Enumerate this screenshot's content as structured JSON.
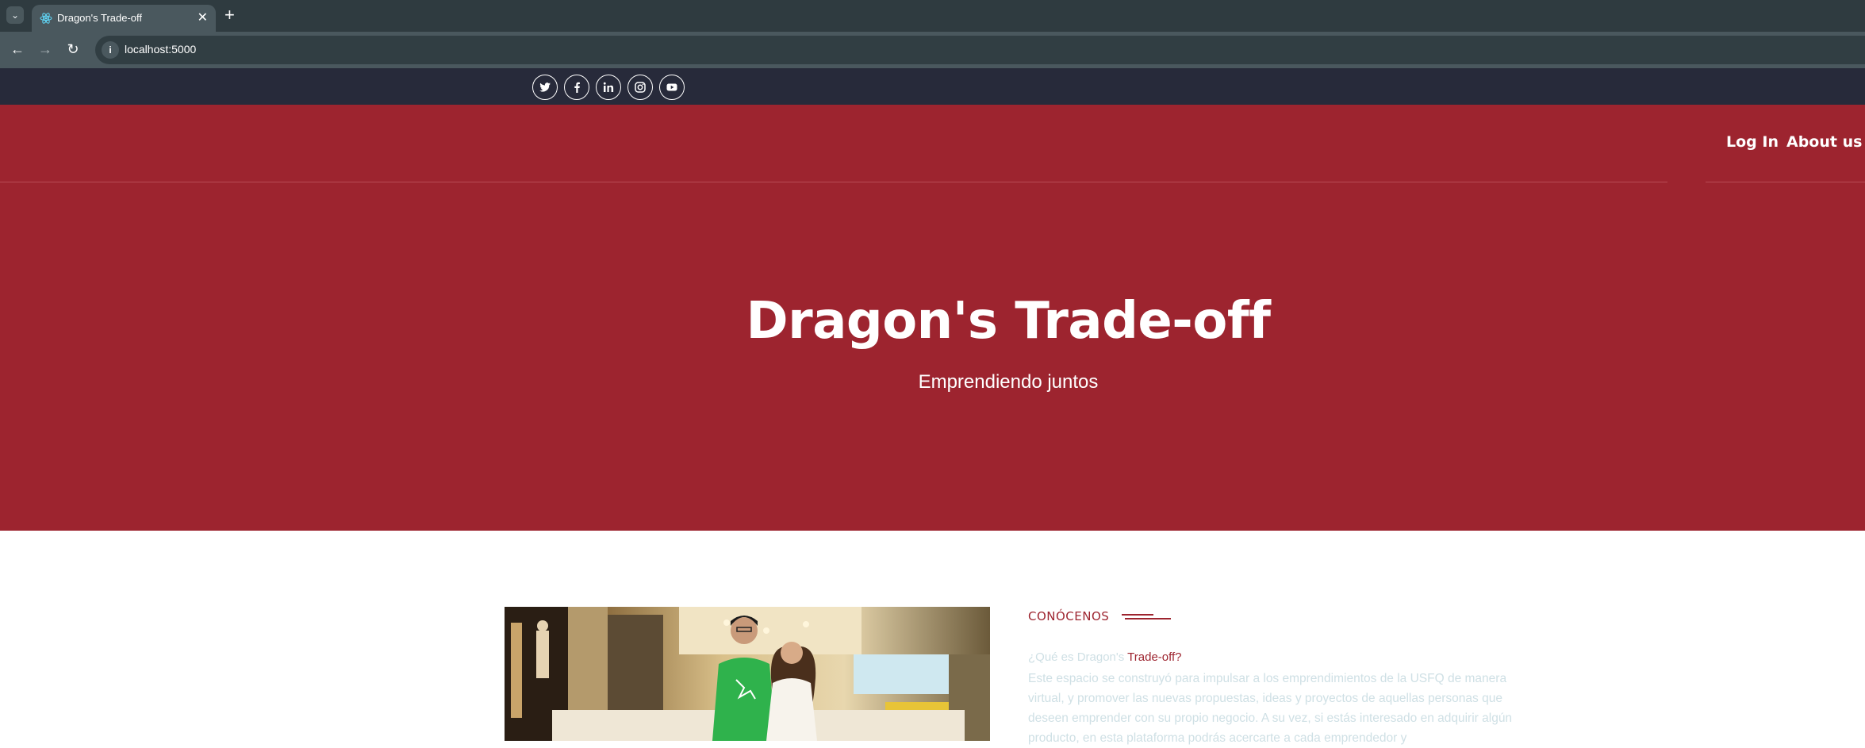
{
  "browser": {
    "tab_title": "Dragon's Trade-off",
    "new_tab_label": "+",
    "url": "localhost:5000"
  },
  "social": {
    "items": [
      "twitter",
      "facebook",
      "linkedin",
      "instagram",
      "youtube"
    ]
  },
  "nav": {
    "login": "Log In",
    "about": "About us"
  },
  "hero": {
    "title": "Dragon's Trade-off",
    "subtitle": "Emprendiendo juntos"
  },
  "about": {
    "label": "CONÓCENOS",
    "question_faded": "¿Qué es Dragon's ",
    "question_highlight": "Trade-off?",
    "body": "Este espacio se construyó para impulsar a los emprendimientos de la USFQ de manera virtual, y promover las nuevas propuestas, ideas y proyectos de aquellas personas que deseen emprender con su propio negocio. A su vez, si estás interesado en adquirir algún producto, en esta plataforma podrás acercarte a cada emprendedor y"
  },
  "colors": {
    "brand_red": "#9d242f",
    "top_bar": "#272a3a"
  }
}
